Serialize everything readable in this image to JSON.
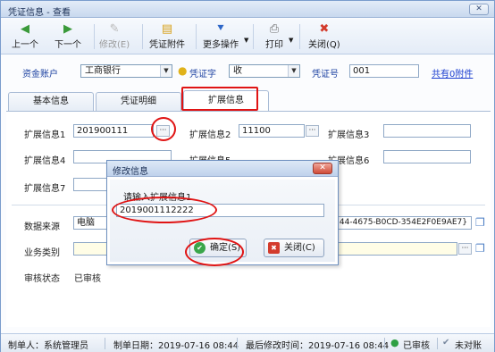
{
  "window": {
    "title": "凭证信息 - 查看",
    "close_glyph": "✕"
  },
  "toolbar": {
    "prev": {
      "label": "上一个",
      "icon": "left-arrow-icon"
    },
    "next": {
      "label": "下一个",
      "icon": "right-arrow-icon"
    },
    "edit": {
      "label": "修改(E)",
      "icon": "edit-icon",
      "disabled": true
    },
    "attach": {
      "label": "凭证附件",
      "icon": "attachment-icon"
    },
    "more": {
      "label": "更多操作",
      "icon": "more-icon"
    },
    "print": {
      "label": "打印",
      "icon": "printer-icon"
    },
    "close": {
      "label": "关闭(Q)",
      "icon": "close-icon"
    }
  },
  "header": {
    "account_label": "资金账户",
    "account_value": "工商银行",
    "voucher_type_label": "凭证字",
    "voucher_type_value": "收",
    "voucher_no_label": "凭证号",
    "voucher_no_value": "001",
    "attachments_link": "共有0附件"
  },
  "tabs": [
    {
      "label": "基本信息",
      "active": false
    },
    {
      "label": "凭证明细",
      "active": false
    },
    {
      "label": "扩展信息",
      "active": true
    }
  ],
  "ext": {
    "f1_label": "扩展信息1",
    "f1_value": "201900111",
    "f2_label": "扩展信息2",
    "f2_value": "11100",
    "f3_label": "扩展信息3",
    "f3_value": "",
    "f4_label": "扩展信息4",
    "f4_value": "",
    "f5_label": "扩展信息5",
    "f6_label": "扩展信息6",
    "f6_value": "",
    "f7_label": "扩展信息7",
    "f7_value": ""
  },
  "data_source": {
    "label": "数据来源",
    "value": "电脑",
    "guid_tail": "44-4675-B0CD-354E2F0E9AE7}"
  },
  "biz_type": {
    "label": "业务类别",
    "value": ""
  },
  "audit": {
    "label": "审核状态",
    "value": "已审核"
  },
  "dialog": {
    "title": "修改信息",
    "prompt": "请输入扩展信息1",
    "value": "2019001112222",
    "ok_label": "确定(S)",
    "cancel_label": "关闭(C)",
    "close_glyph": "✕"
  },
  "status": {
    "creator": "制单人：系统管理员",
    "create_date": "制单日期：2019-07-16 08:44",
    "modified": "最后修改时间：2019-07-16 08:44",
    "audited": "已审核",
    "reconciled": "未对账"
  },
  "colors": {
    "accent": "#1c3fd0",
    "highlight": "#e01414",
    "ok_green": "#3aa64a",
    "cancel_red": "#d33b2c"
  }
}
